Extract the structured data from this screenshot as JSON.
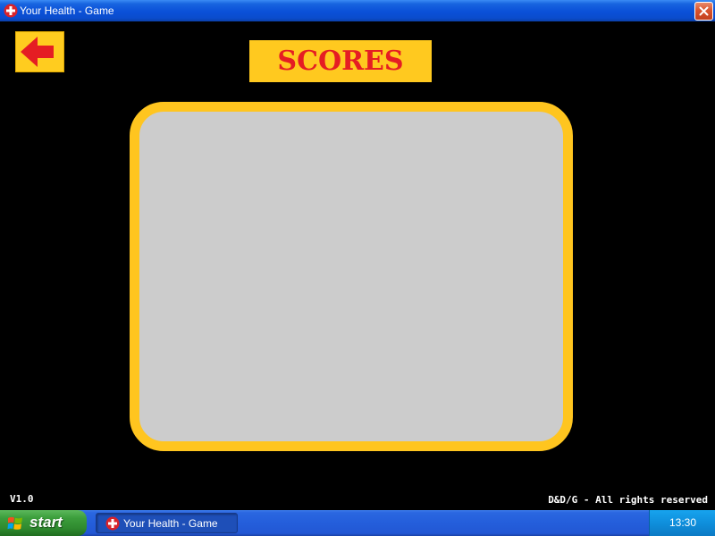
{
  "window": {
    "title": "Your Health - Game",
    "app_icon": "red-cross-icon",
    "close_icon": "close-icon"
  },
  "game": {
    "heading": "SCORES",
    "back_icon": "back-arrow-icon",
    "version": "V1.0",
    "copyright": "D&D/G - All rights reserved"
  },
  "taskbar": {
    "start_label": "start",
    "start_icon": "windows-logo-icon",
    "items": [
      {
        "label": "Your Health - Game",
        "icon": "red-cross-icon"
      }
    ],
    "clock": "13:30"
  },
  "colors": {
    "background": "#000000",
    "accent_yellow": "#ffc91f",
    "heading_red": "#e51d23",
    "panel_gray": "#cccccc"
  }
}
